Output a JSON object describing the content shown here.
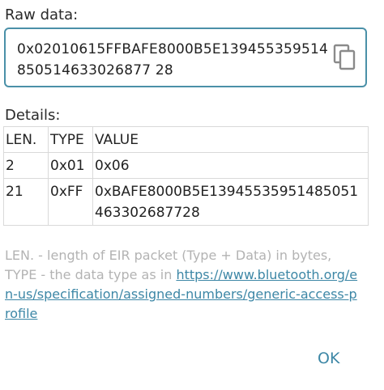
{
  "raw": {
    "label": "Raw data:",
    "value": "0x02010615FFBAFE8000B5E139455359514850514633026877 28"
  },
  "details": {
    "label": "Details:",
    "headers": {
      "len": "LEN.",
      "type": "TYPE",
      "value": "VALUE"
    },
    "rows": [
      {
        "len": "2",
        "type": "0x01",
        "value": "0x06"
      },
      {
        "len": "21",
        "type": "0xFF",
        "value": "0xBAFE8000B5E13945535951485051463302687728"
      }
    ]
  },
  "help": {
    "text": "LEN. - length of EIR packet (Type + Data) in bytes, TYPE - the data type as in ",
    "link": "https://www.bluetooth.org/en-us/specification/assigned-numbers/generic-access-profile"
  },
  "actions": {
    "ok": "OK"
  },
  "icons": {
    "copy": "copy-icon"
  }
}
